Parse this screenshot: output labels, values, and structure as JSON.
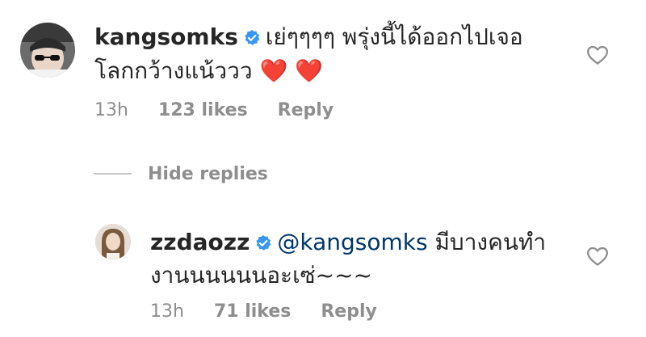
{
  "comments": [
    {
      "username": "kangsomks",
      "verified": true,
      "text_line1": "เย่ๆๆๆๆ พรุ่งนี้ได้ออกไปเจอ",
      "text_line2": "โลกกว้างแน้ววว ❤️ ❤️",
      "time": "13h",
      "likes": "123 likes",
      "reply_label": "Reply",
      "avatar_icon": "user-avatar-sunglasses"
    }
  ],
  "thread": {
    "hide_replies_label": "Hide replies"
  },
  "replies": [
    {
      "username": "zzdaozz",
      "verified": true,
      "mention": "@kangsomks",
      "text_line1_rest": " มีบางคนทำ",
      "text_line2": "งานนนนนนอะเซ่~~~",
      "time": "13h",
      "likes": "71 likes",
      "reply_label": "Reply",
      "avatar_icon": "user-avatar-woman"
    }
  ],
  "icons": {
    "like": "heart-outline-icon",
    "verified": "verified-badge-icon"
  },
  "colors": {
    "verified_blue": "#3897f0",
    "meta_gray": "#8e8e8e",
    "mention_blue": "#00376b"
  }
}
